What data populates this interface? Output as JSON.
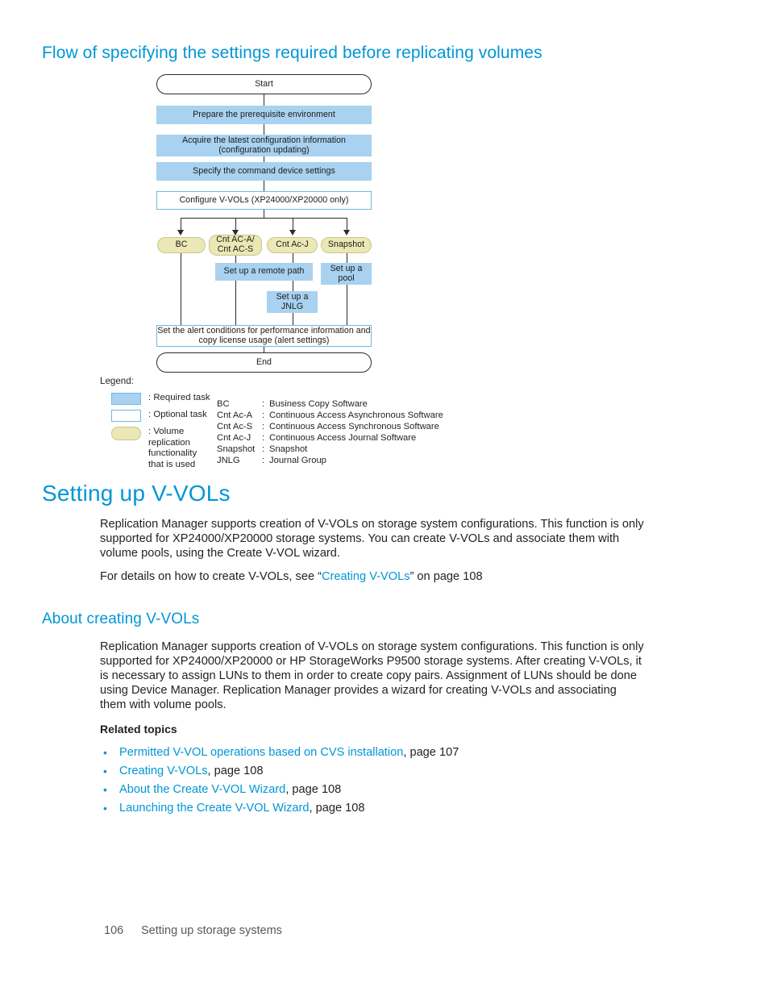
{
  "page": {
    "section_heading": "Flow of specifying the settings required before replicating volumes",
    "footer": {
      "page_number": "106",
      "running_head": "Setting up storage systems"
    }
  },
  "flowchart": {
    "nodes": {
      "start": "Start",
      "prepare": "Prepare the prerequisite environment",
      "acquire_line1": "Acquire the latest configuration information",
      "acquire_line2": "(configuration updating)",
      "specify": "Specify the command device settings",
      "configure": "Configure V-VOLs (XP24000/XP20000 only)",
      "bc": "BC",
      "cnt_ac_as_line1": "Cnt AC-A/",
      "cnt_ac_as_line2": "Cnt AC-S",
      "cnt_ac_j": "Cnt Ac-J",
      "snapshot": "Snapshot",
      "remote_path": "Set up a remote path",
      "pool_line1": "Set up a",
      "pool_line2": "pool",
      "jnlg_line1": "Set up a",
      "jnlg_line2": "JNLG",
      "alert_line1": "Set the alert conditions for performance information and",
      "alert_line2": "copy license usage (alert settings)",
      "end": "End"
    },
    "colors": {
      "required_task": "#a8d2f0",
      "optional_task_border": "#6fb8e8",
      "volume_replication": "#ebe8b5",
      "line": "#2b2b2b"
    }
  },
  "legend": {
    "title": "Legend:",
    "items": [
      {
        "swatch": "required",
        "label": ": Required task"
      },
      {
        "swatch": "optional",
        "label": ": Optional task"
      },
      {
        "swatch": "oval",
        "label": ": Volume\nreplication\nfunctionality\nthat is used"
      }
    ],
    "abbreviations": [
      {
        "key": "BC",
        "value": "Business Copy Software"
      },
      {
        "key": "Cnt Ac-A",
        "value": "Continuous Access Asynchronous Software"
      },
      {
        "key": "Cnt Ac-S",
        "value": "Continuous Access Synchronous Software"
      },
      {
        "key": "Cnt Ac-J",
        "value": "Continuous Access Journal Software"
      },
      {
        "key": "Snapshot",
        "value": "Snapshot"
      },
      {
        "key": "JNLG",
        "value": "Journal Group"
      }
    ]
  },
  "setting_up_vvols": {
    "heading": "Setting up V-VOLs",
    "paragraph": "Replication Manager supports creation of V-VOLs on storage system configurations. This function is only supported for XP24000/XP20000 storage systems. You can create V-VOLs and associate them with volume pools, using the Create V-VOL wizard.",
    "details_prefix": "For details on how to create V-VOLs, see “",
    "details_link": "Creating V-VOLs",
    "details_suffix": "” on page 108"
  },
  "about_creating_vvols": {
    "heading": "About creating V-VOLs",
    "paragraph": "Replication Manager supports creation of V-VOLs on storage system configurations. This function is only supported for XP24000/XP20000 or HP StorageWorks P9500 storage systems. After creating V-VOLs, it is necessary to assign LUNs to them in order to create copy pairs. Assignment of LUNs should be done using Device Manager. Replication Manager provides a wizard for creating V-VOLs and associating them with volume pools.",
    "related_topics_heading": "Related topics",
    "related_topics": [
      {
        "link": "Permitted V-VOL operations based on CVS installation",
        "suffix": ", page 107"
      },
      {
        "link": "Creating V-VOLs",
        "suffix": ", page 108"
      },
      {
        "link": "About the Create V-VOL Wizard",
        "suffix": ", page 108"
      },
      {
        "link": "Launching the Create V-VOL Wizard",
        "suffix": ", page 108"
      }
    ]
  }
}
